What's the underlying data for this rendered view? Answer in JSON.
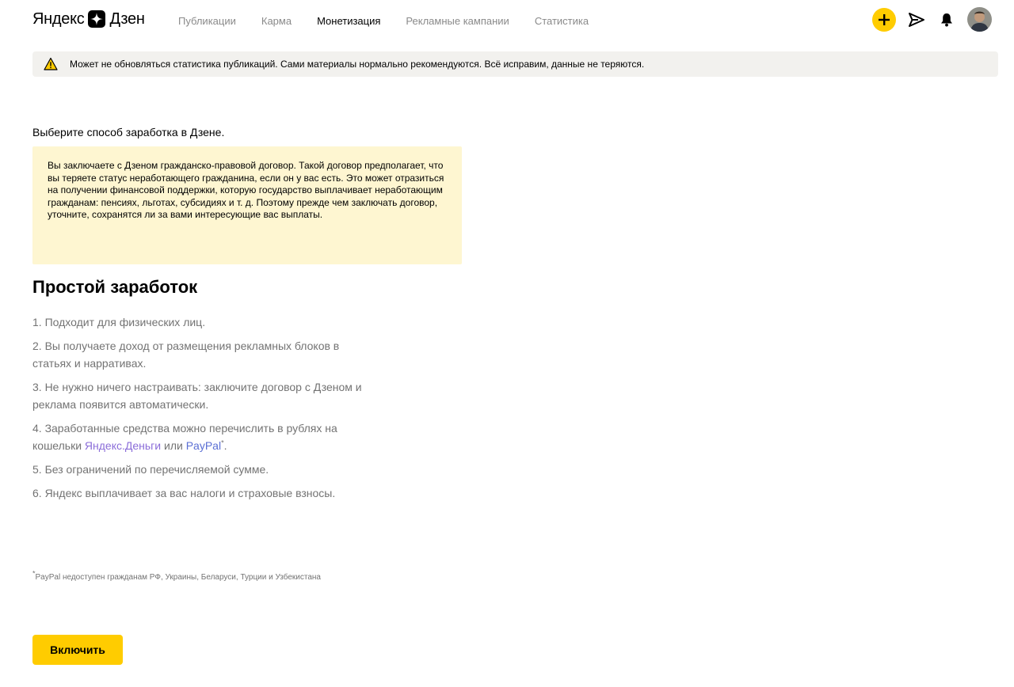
{
  "header": {
    "logo_left": "Яндекс",
    "logo_right": "Дзен",
    "nav": [
      {
        "label": "Публикации",
        "active": false
      },
      {
        "label": "Карма",
        "active": false
      },
      {
        "label": "Монетизация",
        "active": true
      },
      {
        "label": "Рекламные кампании",
        "active": false
      },
      {
        "label": "Статистика",
        "active": false
      }
    ],
    "icons": [
      "plus-icon",
      "send-icon",
      "bell-icon",
      "avatar"
    ],
    "accent_color": "#ffcc00"
  },
  "notice": {
    "icon": "warning-icon",
    "text": "Может не обновляться статистика публикаций. Сами материалы нормально рекомендуются. Всё исправим, данные не теряются."
  },
  "main": {
    "intro": "Выберите способ заработка в Дзене.",
    "warning_text": "Вы заключаете с Дзеном гражданско-правовой договор. Такой договор предполагает, что вы теряете статус неработающего гражданина, если он у вас есть. Это может отразиться на получении финансовой поддержки, которую государство выплачивает неработающим гражданам: пенсиях, льготах, субсидиях и т. д. Поэтому прежде чем заключать договор, уточните, сохранятся ли за вами интересующие вас выплаты.",
    "section_title": "Простой заработок",
    "items": [
      "1. Подходит для физических лиц.",
      "2. Вы получаете доход от размещения рекламных блоков в статьях и нарративах.",
      "3. Не нужно ничего настраивать: заключите договор с Дзеном и реклама появится автоматически."
    ],
    "item4": {
      "prefix": "4. Заработанные средства можно перечислить в рублях на кошельки ",
      "link1": "Яндекс.Деньги",
      "middle": " или ",
      "link2": "PayPal",
      "sup": "*",
      "suffix": "."
    },
    "items_after": [
      "5. Без ограничений по перечисляемой сумме.",
      "6. Яндекс выплачивает за вас налоги и страховые взносы."
    ],
    "footnote_mark": "*",
    "footnote_text": "PayPal недоступен гражданам РФ, Украины, Беларуси, Турции и Узбекистана",
    "enable_button": "Включить"
  }
}
